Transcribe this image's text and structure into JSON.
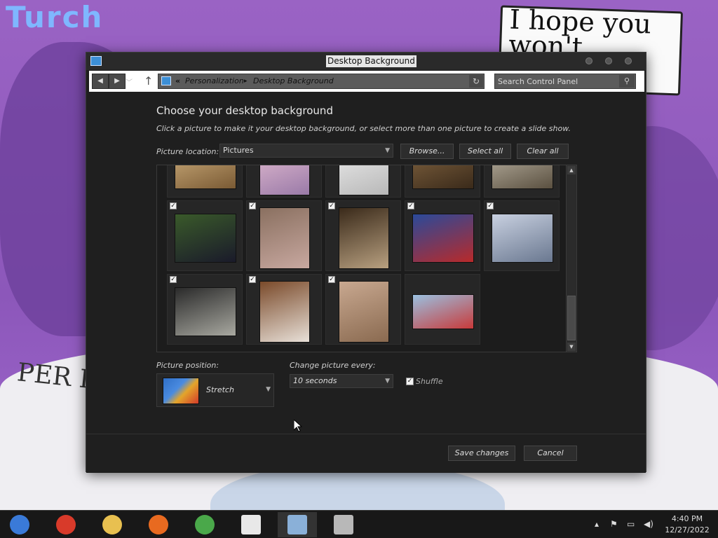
{
  "wallpaper": {
    "title": "Turch",
    "note_text": "I hope you won't",
    "side_text": "PER BEST"
  },
  "window": {
    "title": "Desktop Background",
    "breadcrumb_sep": "«",
    "breadcrumb": [
      "Personalization",
      "Desktop Background"
    ],
    "breadcrumb_arrow": "▸",
    "search_placeholder": "Search Control Panel"
  },
  "content": {
    "heading": "Choose your desktop background",
    "subheading": "Click a picture to make it your desktop background, or select more than one picture to create a slide show.",
    "location_label": "Picture location:",
    "location_value": "Pictures",
    "browse_label": "Browse...",
    "select_all_label": "Select all",
    "clear_all_label": "Clear all",
    "position_label": "Picture position:",
    "position_value": "Stretch",
    "change_label": "Change picture every:",
    "change_value": "10 seconds",
    "shuffle_label": "Shuffle",
    "save_label": "Save changes",
    "cancel_label": "Cancel"
  },
  "tiles": [
    {
      "checked": false,
      "colors": [
        "#d6b784",
        "#7a5a34"
      ]
    },
    {
      "checked": false,
      "colors": [
        "#f0c8d8",
        "#9a7aa8"
      ]
    },
    {
      "checked": false,
      "colors": [
        "#f4f4f4",
        "#b8b8b8"
      ]
    },
    {
      "checked": false,
      "colors": [
        "#8a6a44",
        "#3a2a1a"
      ]
    },
    {
      "checked": false,
      "colors": [
        "#c8c0b0",
        "#5a5040"
      ]
    },
    {
      "checked": true,
      "colors": [
        "#3a5a2a",
        "#1a1a2a"
      ]
    },
    {
      "checked": true,
      "colors": [
        "#8a7060",
        "#c8a8a0"
      ]
    },
    {
      "checked": true,
      "colors": [
        "#3a2a1a",
        "#b8a080"
      ]
    },
    {
      "checked": true,
      "colors": [
        "#2a4a9a",
        "#b82a2a"
      ]
    },
    {
      "checked": true,
      "colors": [
        "#c8d0e0",
        "#6a7890"
      ]
    },
    {
      "checked": true,
      "colors": [
        "#2a2a2a",
        "#a8a8a0"
      ]
    },
    {
      "checked": true,
      "colors": [
        "#7a4a2a",
        "#e8e0d8"
      ]
    },
    {
      "checked": true,
      "colors": [
        "#c8a890",
        "#8a6a50"
      ]
    },
    {
      "checked": false,
      "colors": [
        "#9ac0e0",
        "#c83a3a"
      ]
    }
  ],
  "taskbar": {
    "items": [
      {
        "name": "start-button-icon",
        "color": "#3a7ad8"
      },
      {
        "name": "chrome-icon",
        "color": "#d83a2a"
      },
      {
        "name": "file-explorer-icon",
        "color": "#e8c050"
      },
      {
        "name": "firefox-icon",
        "color": "#e86a20"
      },
      {
        "name": "network-people-icon",
        "color": "#4aa84a"
      },
      {
        "name": "notepad-icon",
        "color": "#e8e8e8"
      },
      {
        "name": "control-panel-icon",
        "color": "#8ab0d8"
      },
      {
        "name": "store-icon",
        "color": "#b8b8b8"
      }
    ],
    "time": "4:40 PM",
    "date": "12/27/2022"
  }
}
